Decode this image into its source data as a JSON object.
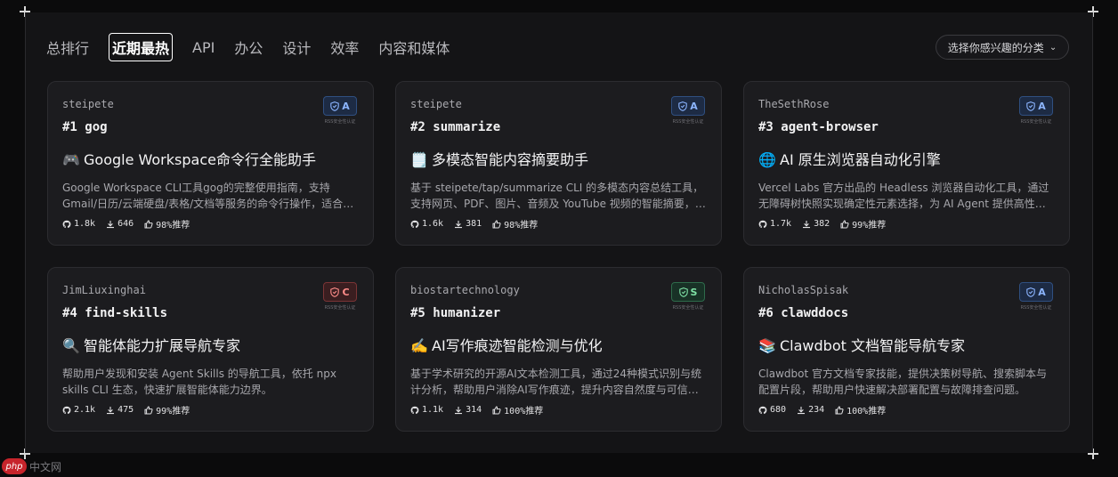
{
  "tabs": [
    {
      "label": "总排行",
      "active": false
    },
    {
      "label": "近期最热",
      "active": true
    },
    {
      "label": "API",
      "active": false
    },
    {
      "label": "办公",
      "active": false
    },
    {
      "label": "设计",
      "active": false
    },
    {
      "label": "效率",
      "active": false
    },
    {
      "label": "内容和媒体",
      "active": false
    }
  ],
  "category_select": {
    "label": "选择你感兴趣的分类",
    "icon": "chevron-down-icon"
  },
  "badge_label": "RSS安全性认证",
  "cards": [
    {
      "author": "steipete",
      "rank": "#1 gog",
      "emoji": "🎮",
      "title": "Google Workspace命令行全能助手",
      "desc": "Google Workspace CLI工具gog的完整使用指南，支持Gmail/日历/云端硬盘/表格/文档等服务的命令行操作，适合自动化办公场景。",
      "stars": "1.8k",
      "downloads": "646",
      "recommend": "98%推荐",
      "grade": "A"
    },
    {
      "author": "steipete",
      "rank": "#2 summarize",
      "emoji": "🗒️",
      "title": "多模态智能内容摘要助手",
      "desc": "基于 steipete/tap/summarize CLI 的多模态内容总结工具，支持网页、PDF、图片、音频及 YouTube 视频的智能摘要，高效提取关键信息。",
      "stars": "1.6k",
      "downloads": "381",
      "recommend": "98%推荐",
      "grade": "A"
    },
    {
      "author": "TheSethRose",
      "rank": "#3 agent-browser",
      "emoji": "🌐",
      "title": "AI 原生浏览器自动化引擎",
      "desc": "Vercel Labs 官方出品的 Headless 浏览器自动化工具，通过无障碍树快照实现确定性元素选择，为 AI Agent 提供高性能、可靠的网页交互能力。",
      "stars": "1.7k",
      "downloads": "382",
      "recommend": "99%推荐",
      "grade": "A"
    },
    {
      "author": "JimLiuxinghai",
      "rank": "#4 find-skills",
      "emoji": "🔍",
      "title": "智能体能力扩展导航专家",
      "desc": "帮助用户发现和安装 Agent Skills 的导航工具，依托 npx skills CLI 生态，快速扩展智能体能力边界。",
      "stars": "2.1k",
      "downloads": "475",
      "recommend": "99%推荐",
      "grade": "C"
    },
    {
      "author": "biostartechnology",
      "rank": "#5 humanizer",
      "emoji": "✍️",
      "title": "AI写作痕迹智能检测与优化",
      "desc": "基于学术研究的开源AI文本检测工具，通过24种模式识别与统计分析，帮助用户消除AI写作痕迹，提升内容自然度与可信度。",
      "stars": "1.1k",
      "downloads": "314",
      "recommend": "100%推荐",
      "grade": "S"
    },
    {
      "author": "NicholasSpisak",
      "rank": "#6 clawddocs",
      "emoji": "📚",
      "title": "Clawdbot 文档智能导航专家",
      "desc": "Clawdbot 官方文档专家技能，提供决策树导航、搜索脚本与配置片段，帮助用户快速解决部署配置与故障排查问题。",
      "stars": "680",
      "downloads": "234",
      "recommend": "100%推荐",
      "grade": "A"
    }
  ],
  "watermark": {
    "logo": "php",
    "text": "中文网"
  },
  "colors": {
    "grade_A": "#8cb5ff",
    "grade_C": "#ff8d8a",
    "grade_S": "#7fe2a6"
  }
}
